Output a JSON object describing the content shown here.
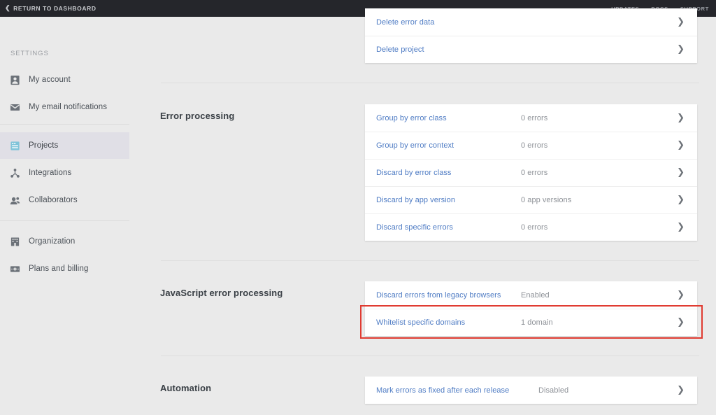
{
  "topbar": {
    "back_link": "RETURN TO DASHBOARD",
    "back_chevron": "chevron-left-icon",
    "links": [
      "UPDATES",
      "DOCS",
      "SUPPORT"
    ],
    "background_color": "#25262b"
  },
  "sidebar": {
    "heading": "SETTINGS",
    "items": [
      {
        "label": "My account",
        "icon": "user-card-icon",
        "selected": false
      },
      {
        "label": "My email notifications",
        "icon": "envelope-icon",
        "selected": false
      },
      {
        "label": "Projects",
        "icon": "list-card-icon",
        "selected": true
      },
      {
        "label": "Integrations",
        "icon": "integrations-node-icon",
        "selected": false
      },
      {
        "label": "Collaborators",
        "icon": "people-icon",
        "selected": false
      },
      {
        "label": "Organization",
        "icon": "building-icon",
        "selected": false
      },
      {
        "label": "Plans and billing",
        "icon": "banknote-icon",
        "selected": false
      }
    ],
    "selected_background": "#e0dfe6",
    "selected_icon_color": "#7fc4d9"
  },
  "main": {
    "link_color": "#4f7cc4",
    "value_color": "#8d9197",
    "background_color": "#eaeaea",
    "top_card_rows": [
      {
        "label": "Delete error data",
        "value": "",
        "chevron": "chevron-right-icon"
      },
      {
        "label": "Delete project",
        "value": "",
        "chevron": "chevron-right-icon"
      }
    ],
    "sections": [
      {
        "title": "Error processing",
        "rows": [
          {
            "label": "Group by error class",
            "value": "0 errors",
            "chevron": "chevron-right-icon"
          },
          {
            "label": "Group by error context",
            "value": "0 errors",
            "chevron": "chevron-right-icon"
          },
          {
            "label": "Discard by error class",
            "value": "0 errors",
            "chevron": "chevron-right-icon"
          },
          {
            "label": "Discard by app version",
            "value": "0 app versions",
            "chevron": "chevron-right-icon"
          },
          {
            "label": "Discard specific errors",
            "value": "0 errors",
            "chevron": "chevron-right-icon"
          }
        ]
      },
      {
        "title": "JavaScript error processing",
        "rows": [
          {
            "label": "Discard errors from legacy browsers",
            "value": "Enabled",
            "chevron": "chevron-right-icon"
          },
          {
            "label": "Whitelist specific domains",
            "value": "1 domain",
            "chevron": "chevron-right-icon"
          }
        ]
      },
      {
        "title": "Automation",
        "rows": [
          {
            "label": "Mark errors as fixed after each release",
            "value": "Disabled",
            "chevron": "chevron-right-icon"
          }
        ]
      }
    ],
    "highlight": {
      "target_row_label": "Whitelist specific domains",
      "color": "#e03b31"
    }
  }
}
